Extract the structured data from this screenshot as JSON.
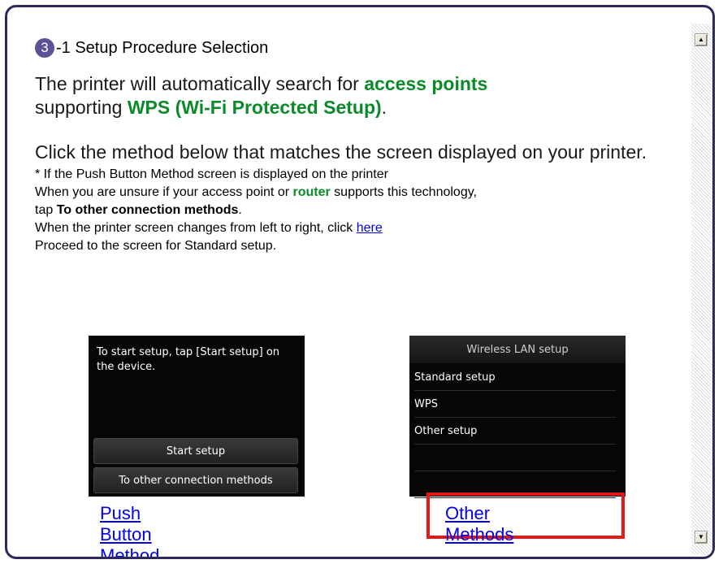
{
  "step": {
    "number": "3",
    "title": "-1 Setup Procedure Selection"
  },
  "intro": {
    "part1": "The printer will automatically search for ",
    "highlight1": "access points",
    "part2": "supporting ",
    "highlight2": "WPS (Wi-Fi Protected Setup)",
    "part3": "."
  },
  "instruction": {
    "line": "Click the method below that matches the screen displayed on your printer."
  },
  "note": {
    "line1": "* If the Push Button Method screen is displayed on the printer",
    "line2a": "When you are unsure if your access point or ",
    "line2_highlight": "router",
    "line2b": " supports this technology,",
    "line3a": "tap ",
    "line3_bold": "To other connection methods",
    "line3b": ".",
    "line4a": "When the printer screen changes from left to right, click ",
    "line4_link": "here",
    "line5": "Proceed to the screen for Standard setup."
  },
  "push_screen": {
    "message": "To start setup, tap [Start setup] on the device.",
    "button1": "Start setup",
    "button2": "To other connection methods"
  },
  "other_screen": {
    "title": "Wireless LAN setup",
    "items": [
      "Standard setup",
      "WPS",
      "Other setup",
      "",
      ""
    ]
  },
  "methods": {
    "push_label": "Push Button Method",
    "other_label": "Other Methods"
  },
  "colors": {
    "accent_green": "#0a8a28",
    "badge_purple": "#5c5296",
    "highlight_red": "#e41818",
    "link_blue": "#0000ee"
  },
  "icons": {
    "scroll_up": "scroll-up-arrow-icon",
    "scroll_down": "scroll-down-arrow-icon"
  }
}
